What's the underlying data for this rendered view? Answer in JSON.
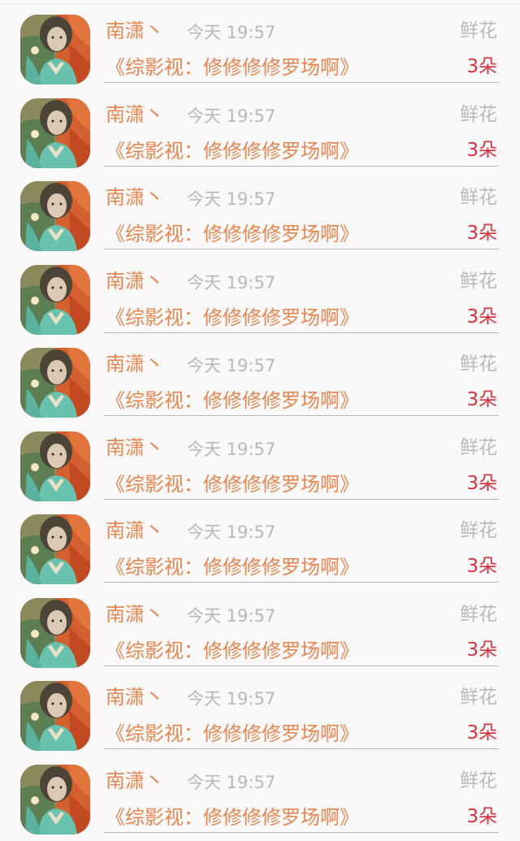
{
  "items": [
    {
      "sender": "南潇丶",
      "time": "今天 19:57",
      "gift_label": "鲜花",
      "title": "《综影视：修修修修罗场啊》",
      "count": "3朵"
    },
    {
      "sender": "南潇丶",
      "time": "今天 19:57",
      "gift_label": "鲜花",
      "title": "《综影视：修修修修罗场啊》",
      "count": "3朵"
    },
    {
      "sender": "南潇丶",
      "time": "今天 19:57",
      "gift_label": "鲜花",
      "title": "《综影视：修修修修罗场啊》",
      "count": "3朵"
    },
    {
      "sender": "南潇丶",
      "time": "今天 19:57",
      "gift_label": "鲜花",
      "title": "《综影视：修修修修罗场啊》",
      "count": "3朵"
    },
    {
      "sender": "南潇丶",
      "time": "今天 19:57",
      "gift_label": "鲜花",
      "title": "《综影视：修修修修罗场啊》",
      "count": "3朵"
    },
    {
      "sender": "南潇丶",
      "time": "今天 19:57",
      "gift_label": "鲜花",
      "title": "《综影视：修修修修罗场啊》",
      "count": "3朵"
    },
    {
      "sender": "南潇丶",
      "time": "今天 19:57",
      "gift_label": "鲜花",
      "title": "《综影视：修修修修罗场啊》",
      "count": "3朵"
    },
    {
      "sender": "南潇丶",
      "time": "今天 19:57",
      "gift_label": "鲜花",
      "title": "《综影视：修修修修罗场啊》",
      "count": "3朵"
    },
    {
      "sender": "南潇丶",
      "time": "今天 19:57",
      "gift_label": "鲜花",
      "title": "《综影视：修修修修罗场啊》",
      "count": "3朵"
    },
    {
      "sender": "南潇丶",
      "time": "今天 19:57",
      "gift_label": "鲜花",
      "title": "《综影视：修修修修罗场啊》",
      "count": "3朵"
    }
  ],
  "colors": {
    "sender": "#e7874f",
    "title": "#e7874f",
    "muted": "#b9b9b9",
    "count": "#d5323c",
    "background": "#faf8f9"
  },
  "avatar_icon": "user-avatar-icon"
}
